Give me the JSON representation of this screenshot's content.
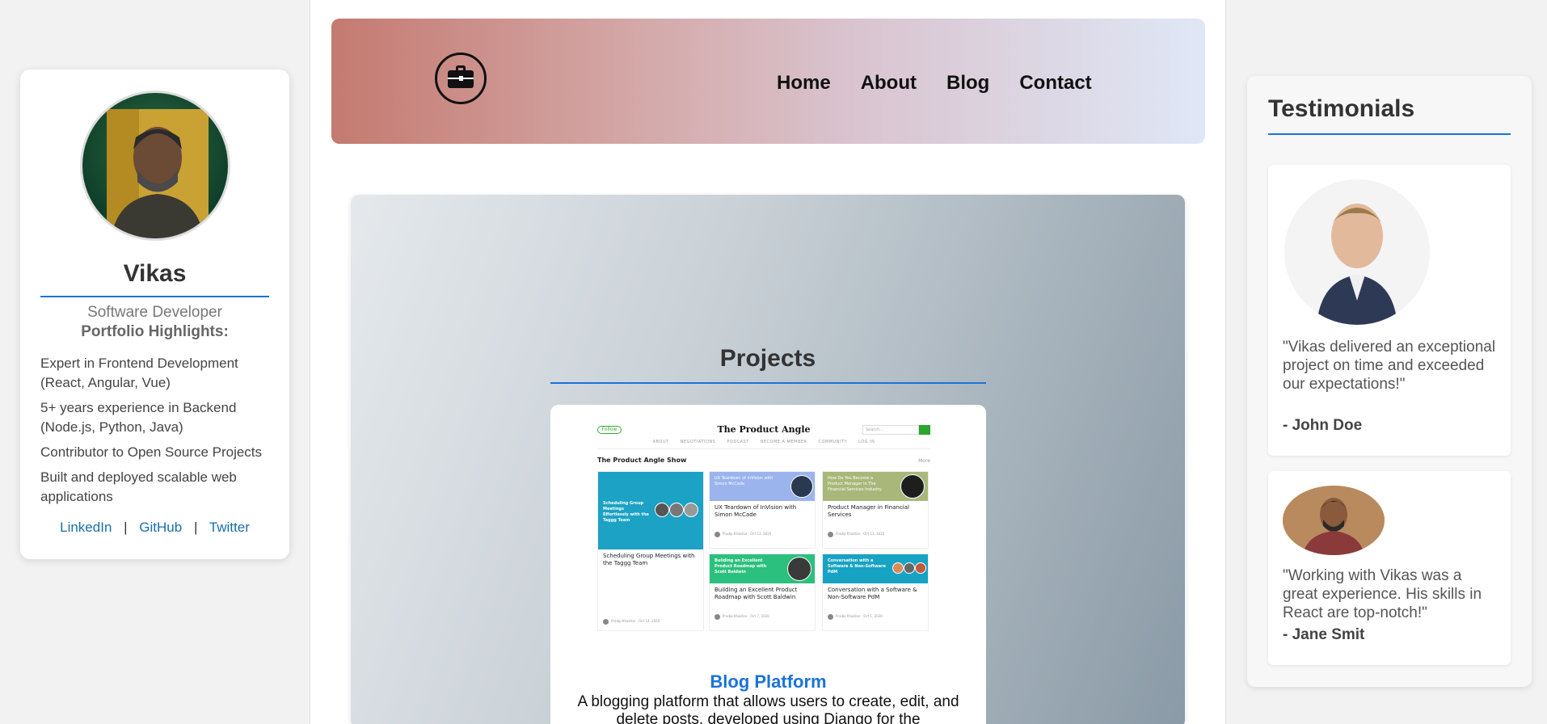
{
  "profile": {
    "name": "Vikas",
    "role": "Software Developer",
    "highlights_title": "Portfolio Highlights:",
    "highlights": [
      "Expert in Frontend Development (React, Angular, Vue)",
      "5+ years experience in Backend (Node.js, Python, Java)",
      "Contributor to Open Source Projects",
      "Built and deployed scalable web applications"
    ],
    "social": [
      "LinkedIn",
      "GitHub",
      "Twitter"
    ],
    "separator": "|"
  },
  "nav": {
    "logo_icon": "briefcase-icon",
    "links": [
      "Home",
      "About",
      "Blog",
      "Contact"
    ]
  },
  "projects": {
    "title": "Projects",
    "items": [
      {
        "name": "Blog Platform",
        "description": "A blogging platform that allows users to create, edit, and delete posts, developed using Django for the",
        "screenshot": {
          "site_title": "The Product Angle",
          "follow": "Follow",
          "search": "Search...",
          "menu": [
            "ABOUT",
            "NEGOTIATIONS",
            "PODCAST",
            "BECOME A MEMBER",
            "COMMUNITY",
            "LOG IN"
          ],
          "section": "The Product Angle Show",
          "more": "More",
          "tiles": [
            {
              "title": "Scheduling Group Meetings with the Taggg Team",
              "img_text": "Scheduling Group Meetings Effortlessly with the Taggg Team",
              "meta": "Pradip Khakhar · Oct 14, 2020"
            },
            {
              "title": "UX Teardown of InVision with Simon McCade",
              "img_text": "UX Teardown of InVision with Simon McCade",
              "meta": "Pradip Khakhar · Oct 13, 2020"
            },
            {
              "title": "Product Manager in Financial Services",
              "img_text": "How Do You Become a Product Manager in The Financial Services Industry",
              "meta": "Pradip Khakhar · Oct 13, 2020"
            },
            {
              "title": "Building an Excellent Product Roadmap with Scott Baldwin",
              "img_text": "Building an Excellent Product Roadmap with Scott Baldwin",
              "meta": "Pradip Khakhar · Oct 7, 2020"
            },
            {
              "title": "Conversation with a Software & Non-Software PdM",
              "img_text": "Conversation with a Software & Non-Software PdM",
              "meta": "Pradip Khakhar · Oct 1, 2020"
            }
          ]
        }
      }
    ]
  },
  "testimonials": {
    "title": "Testimonials",
    "items": [
      {
        "quote": "\"Vikas delivered an exceptional project on time and exceeded our expectations!\"",
        "author": "- John Doe"
      },
      {
        "quote": "\"Working with Vikas was a great experience. His skills in React are top-notch!\"",
        "author": "- Jane Smit"
      }
    ]
  },
  "colors": {
    "accent": "#1a73d9",
    "link": "#1a6ea8",
    "nav_gradient": [
      "#c47a70",
      "#dfe7f6"
    ]
  }
}
